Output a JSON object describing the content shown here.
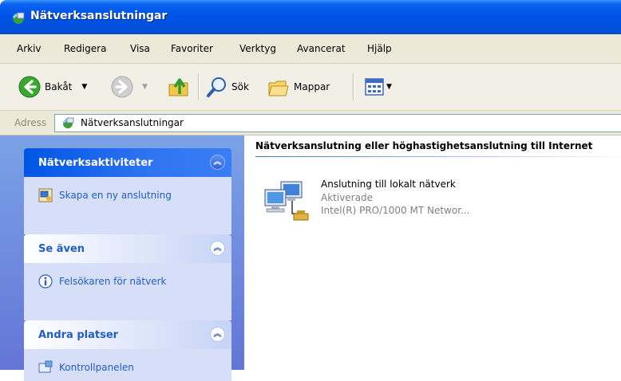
{
  "window": {
    "title": "Nätverksanslutningar"
  },
  "menu": [
    "Arkiv",
    "Redigera",
    "Visa",
    "Favoriter",
    "Verktyg",
    "Avancerat",
    "Hjälp"
  ],
  "toolbar": {
    "back_label": "Bakåt",
    "search_label": "Sök",
    "folders_label": "Mappar"
  },
  "address": {
    "label": "Adress",
    "value": "Nätverksanslutningar"
  },
  "panels": {
    "network_tasks": {
      "title": "Nätverksaktiviteter",
      "items": [
        "Skapa en ny anslutning"
      ]
    },
    "see_also": {
      "title": "Se även",
      "items": [
        "Felsökaren för nätverk"
      ]
    },
    "other_places": {
      "title": "Andra platser",
      "items": [
        "Kontrollpanelen"
      ]
    }
  },
  "content": {
    "group_header": "Nätverksanslutning eller höghastighetsanslutning till Internet",
    "connection": {
      "name": "Anslutning till lokalt nätverk",
      "status": "Aktiverade",
      "device": "Intel(R) PRO/1000 MT Networ..."
    }
  },
  "colors": {
    "title_bar": "#0053e6",
    "task_pane": "#6375d6",
    "link": "#215dc6"
  }
}
